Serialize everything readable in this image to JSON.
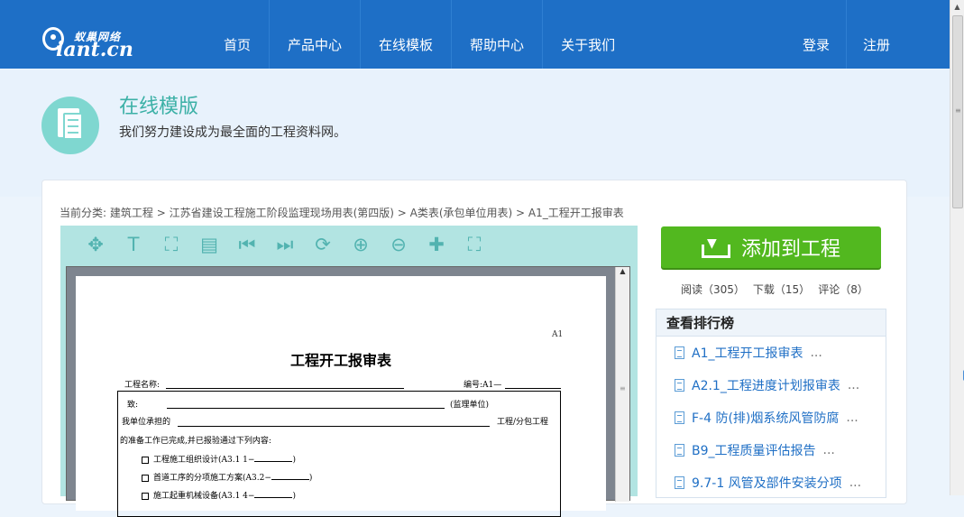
{
  "logo": {
    "cn": "蚁巢网络",
    "en": "iant.cn"
  },
  "nav": {
    "items": [
      "首页",
      "产品中心",
      "在线模板",
      "帮助中心",
      "关于我们"
    ]
  },
  "user": {
    "login": "登录",
    "register": "注册"
  },
  "hero": {
    "title": "在线模版",
    "subtitle": "我们努力建设成为最全面的工程资料网。"
  },
  "breadcrumb": {
    "prefix": "当前分类:",
    "items": [
      "建筑工程",
      "江苏省建设工程施工阶段监理现场用表(第四版)",
      "A类表(承包单位用表)",
      "A1_工程开工报审表"
    ],
    "sep": " > "
  },
  "toolbar": {
    "icons": [
      "move-icon",
      "text-icon",
      "fit-page-icon",
      "page-icon",
      "first-page-icon",
      "last-page-icon",
      "rotate-icon",
      "zoom-in-icon",
      "zoom-out-icon",
      "add-icon",
      "fullscreen-icon"
    ],
    "glyphs": [
      "✥",
      "T",
      "⛶",
      "▤",
      "⏮",
      "⏭",
      "⟳",
      "⊕",
      "⊖",
      "✚",
      "⛶"
    ]
  },
  "document": {
    "code": "A1",
    "title": "工程开工报审表",
    "project_name_label": "工程名称:",
    "number_label": "编号:A1—",
    "to_label": "致:",
    "supervisor": "(监理单位)",
    "line1": "我单位承担的",
    "line1_end": "工程/分包工程",
    "line2": "的准备工作已完成,并已报验通过下列内容:",
    "checks": [
      {
        "text": "工程施工组织设计(A3.1 1−",
        "end": ")"
      },
      {
        "text": "首道工序的分项施工方案(A3.2−",
        "end": ")"
      },
      {
        "text": "施工起重机械设备(A3.1 4−",
        "end": ")"
      }
    ]
  },
  "sidebar": {
    "add_button": "添加到工程",
    "stats": [
      "阅读（305）",
      "下载（15）",
      "评论（8）"
    ],
    "ranking_title": "查看排行榜",
    "ranking": [
      "A1_工程开工报审表",
      "A2.1_工程进度计划报审表",
      "F-4 防(排)烟系统风管防腐",
      "B9_工程质量评估报告",
      "9.7-1 风管及部件安装分项"
    ],
    "more": "..."
  }
}
